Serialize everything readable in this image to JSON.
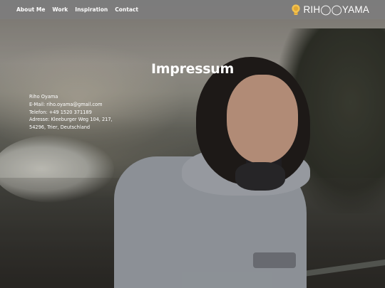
{
  "nav": {
    "links": [
      "About Me",
      "Work",
      "Inspiration",
      "Contact"
    ],
    "logo_text": "RIH◯◯YAMA"
  },
  "page": {
    "title": "Impressum"
  },
  "info": {
    "name": "Riho Oyama",
    "email": "E-Mail: riho.oyama@gmail.com",
    "phone": "Telefon: +49 1520 371189",
    "address_line1": "Adresse: Kleeburger Weg 104, 217,",
    "address_line2": "54296, Trier, Deutschland"
  },
  "colors": {
    "navbar": "#7d7d7d",
    "text": "#ffffff",
    "logo_bulb": "#f2c14e"
  },
  "icons": {
    "logo": "lightbulb-icon"
  }
}
